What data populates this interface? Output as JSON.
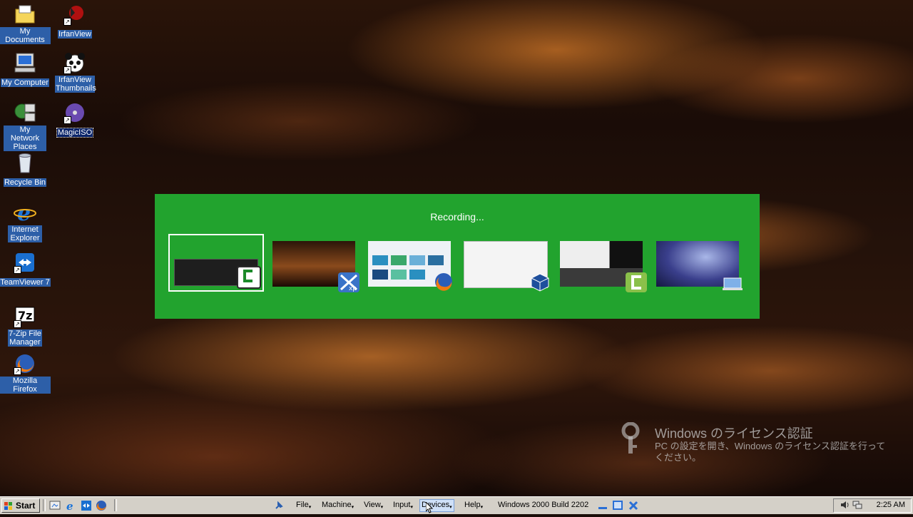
{
  "desktop": {
    "icons": [
      {
        "label": "My Documents",
        "icon": "folder-documents-icon"
      },
      {
        "label": "IrfanView",
        "icon": "irfanview-icon"
      },
      {
        "label": "My Computer",
        "icon": "computer-icon"
      },
      {
        "label": "IrfanView Thumbnails",
        "icon": "panda-icon"
      },
      {
        "label": "My Network Places",
        "icon": "network-icon"
      },
      {
        "label": "MagicISO",
        "icon": "disc-icon"
      },
      {
        "label": "Recycle Bin",
        "icon": "recycle-bin-icon"
      },
      {
        "label": "Internet Explorer",
        "icon": "ie-icon"
      },
      {
        "label": "TeamViewer 7",
        "icon": "teamviewer-icon"
      },
      {
        "label": "7-Zip File Manager",
        "icon": "7zip-icon"
      },
      {
        "label": "Mozilla Firefox",
        "icon": "firefox-icon"
      }
    ]
  },
  "switcher": {
    "title": "Recording...",
    "background": "#22a32e",
    "windows": [
      {
        "app": "camtasia-icon",
        "selected": true
      },
      {
        "app": "windows-xp-icon",
        "selected": false
      },
      {
        "app": "firefox-icon",
        "selected": false
      },
      {
        "app": "virtualbox-icon",
        "selected": false
      },
      {
        "app": "camtasia-icon",
        "selected": false
      },
      {
        "app": "remote-desktop-icon",
        "selected": false
      }
    ]
  },
  "activation": {
    "title": "Windows のライセンス認証",
    "message": "PC の設定を開き、Windows のライセンス認証を行ってください。"
  },
  "taskbar": {
    "start_label": "Start",
    "quick_launch": [
      "show-desktop-icon",
      "ie-icon",
      "teamviewer-icon",
      "firefox-icon"
    ],
    "vm_menu": {
      "items": [
        "File",
        "Machine",
        "View",
        "Input",
        "Devices",
        "Help"
      ],
      "active_item": "Devices",
      "vm_title": "Windows 2000 Build 2202"
    },
    "clock": "2:25 AM"
  }
}
